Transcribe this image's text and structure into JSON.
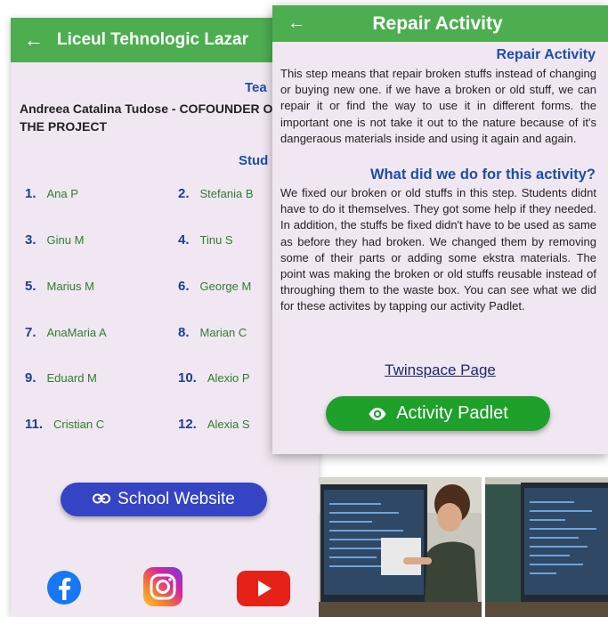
{
  "left_screen": {
    "title": "Liceul Tehnologic Lazar",
    "back_icon": "back-arrow-icon",
    "teacher_heading": "Tea",
    "teacher_name": "Andreea Catalina Tudose - COFOUNDER OF THE PROJECT",
    "students_heading": "Stud",
    "students": [
      {
        "num": "1.",
        "name": "Ana P"
      },
      {
        "num": "2.",
        "name": "Stefania B"
      },
      {
        "num": "3.",
        "name": "Ginu M"
      },
      {
        "num": "4.",
        "name": "Tinu S"
      },
      {
        "num": "5.",
        "name": "Marius M"
      },
      {
        "num": "6.",
        "name": "George M"
      },
      {
        "num": "7.",
        "name": "AnaMaria A"
      },
      {
        "num": "8.",
        "name": "Marian C"
      },
      {
        "num": "9.",
        "name": "Eduard M"
      },
      {
        "num": "10.",
        "name": "Alexio P"
      },
      {
        "num": "11.",
        "name": "Cristian C"
      },
      {
        "num": "12.",
        "name": "Alexia S"
      }
    ],
    "school_button": "School Website",
    "social": [
      "facebook-icon",
      "instagram-icon",
      "youtube-icon"
    ]
  },
  "right_screen": {
    "title": "Repair Activity",
    "heading1": "Repair Activity",
    "text1": "This step means that repair broken stuffs instead of changing or buying new one. if we have a broken or old stuff, we can repair it or find the way to use it in different forms. the important one is not take it out to the nature because of it's dangeraous materials inside and using it again and again.",
    "heading2": "What did we do for this activity?",
    "text2": "We fixed our broken or old stuffs in this step. Students didnt have to do it themselves. They got some help if they needed. In addition, the stuffs be fixed didn't have to be used as same as before they had broken. We changed them by removing some of their parts or adding some ekstra materials. The point was making the broken or old stuffs reusable instead of throughing them to the waste box. You can see what we did for these activites by tapping our activity Padlet.",
    "twinspace_link": "Twinspace Page",
    "padlet_button": "Activity Padlet"
  },
  "colors": {
    "appbar_green": "#4cae4f",
    "heading_blue": "#1c4fa5",
    "school_button": "#3544c5",
    "padlet_button": "#1ea02b",
    "background": "#f1e7f2"
  }
}
